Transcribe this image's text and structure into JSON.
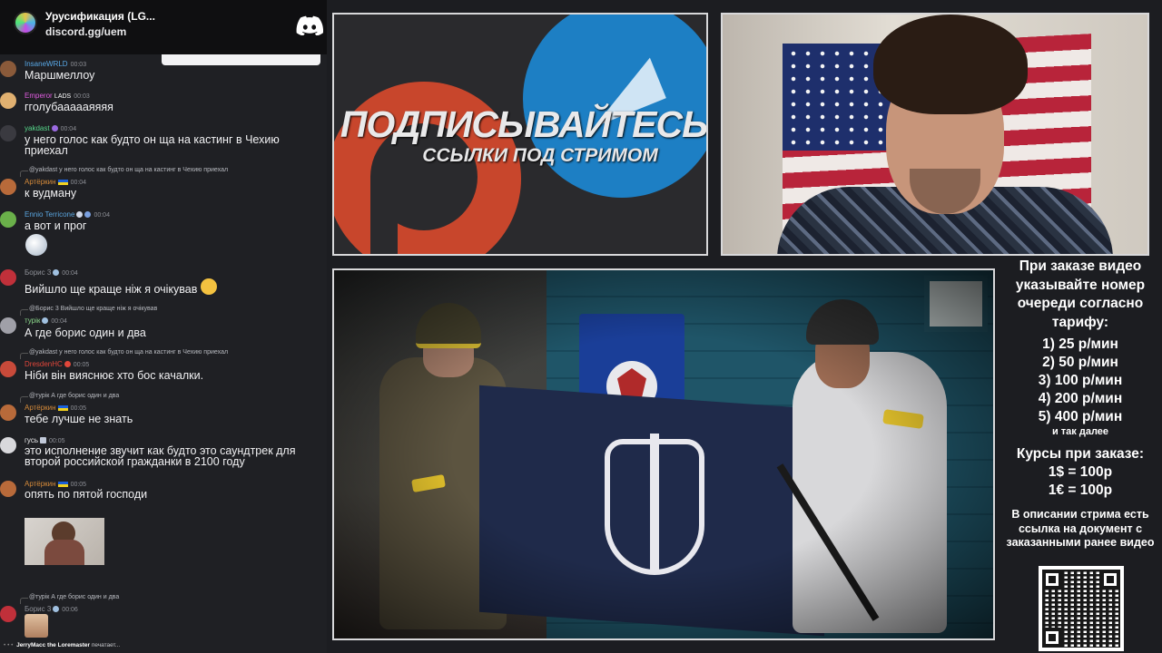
{
  "chat": {
    "server_name": "Урусификация (LG...",
    "server_link": "discord.gg/uem",
    "messages": [
      {
        "author": "InsaneWRLD",
        "author_color": "#59a9e8",
        "time": "00:03",
        "text": "Маршмеллоу"
      },
      {
        "author": "Emperor",
        "author_color": "#e05ce0",
        "tag": "LADS",
        "time": "00:03",
        "text": "гголубаааааяяяя"
      },
      {
        "author": "yakdast",
        "author_color": "#56d68a",
        "time": "00:04",
        "text": "у него голос как будто он ща на кастинг в Чехию приехал"
      },
      {
        "reply": "@yakdast у него голос как будто он ща на кастинг в Чехию приехал",
        "author": "Артёркин",
        "author_color": "#d48a3a",
        "time": "00:04",
        "text": "к вудману"
      },
      {
        "author": "Ennio Terricone",
        "author_color": "#5aa6e0",
        "time": "00:04",
        "text": "а вот и прог"
      },
      {
        "author": "Борис 3",
        "author_color": "#8e9097",
        "time": "00:04",
        "text": "Вийшло ще краще ніж я очікував"
      },
      {
        "reply": "@Борис 3 Вийшло ще краще ніж я очікував",
        "author": "турік",
        "author_color": "#8ad68a",
        "time": "00:04",
        "text": "А где борис один и два"
      },
      {
        "reply": "@yakdast у него голос как будто он ща на кастинг в Чехию приехал",
        "author": "DresdenHC",
        "author_color": "#e0463a",
        "time": "00:05",
        "text": "Ніби він вияснює хто бос качалки."
      },
      {
        "reply": "@турік А где борис один и два",
        "author": "Артёркин",
        "author_color": "#d48a3a",
        "time": "00:05",
        "text": "тебе лучше не знать"
      },
      {
        "author": "гусь",
        "author_color": "#e8e8ea",
        "time": "00:05",
        "text": "это исполнение звучит как будто это саундтрек для второй российской гражданки в 2100 году"
      },
      {
        "author": "Артёркин",
        "author_color": "#d48a3a",
        "time": "00:05",
        "text": "опять по пятой господи"
      },
      {
        "reply": "@турік А где борис один и два",
        "author": "Борис 3",
        "author_color": "#8e9097",
        "time": "00:06",
        "text": ""
      }
    ],
    "typing_user": "JerryMacc the Loremaster",
    "typing_suffix": " печатает..."
  },
  "promo": {
    "title": "ПОДПИСЫВАЙТЕСЬ",
    "subtitle": "ССЫЛКИ ПОД СТРИМОМ"
  },
  "info": {
    "head": "При заказе видео указывайте номер очереди согласно тарифу:",
    "tariffs": [
      "1) 25 р/мин",
      "2) 50 р/мин",
      "3) 100 р/мин",
      "4) 200 р/мин",
      "5) 400 р/мин"
    ],
    "tariffs_more": "и так далее",
    "rates_head": "Курсы при заказе:",
    "rates": [
      "1$ = 100р",
      "1€ = 100р"
    ],
    "desc": "В описании стрима есть ссылка на документ с заказанными ранее видео"
  },
  "icons": {
    "discord": "discord-icon",
    "server": "server-icon"
  }
}
